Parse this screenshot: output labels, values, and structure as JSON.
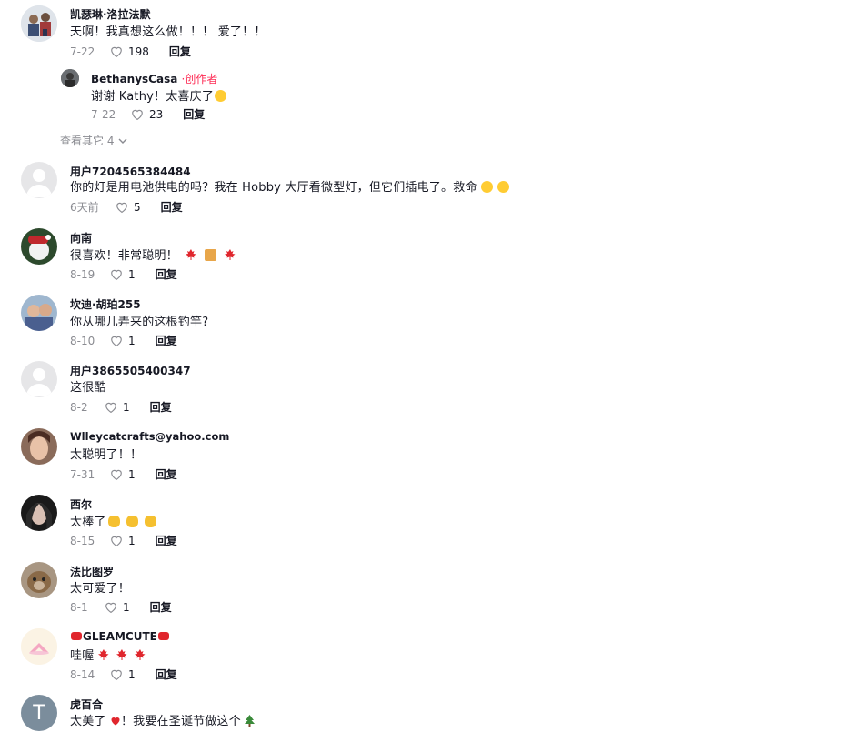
{
  "comments": [
    {
      "name": "凯瑟琳·洛拉法默",
      "text": "天啊！我真想这么做！！！ 爱了！！",
      "date": "7-22",
      "likes": "198",
      "reply": "回复"
    },
    {
      "name": "用户7204565384484",
      "text": "你的灯是用电池供电的吗？我在 Hobby 大厅看微型灯，但它们插电了。救命",
      "date": "6天前",
      "likes": "5",
      "reply": "回复"
    },
    {
      "name": "向南",
      "text": "很喜欢！非常聪明！",
      "date": "8-19",
      "likes": "1",
      "reply": "回复"
    },
    {
      "name": "坎迪·胡珀255",
      "text": "你从哪儿弄来的这根钓竿?",
      "date": "8-10",
      "likes": "1",
      "reply": "回复"
    },
    {
      "name": "用户3865505400347",
      "text": "这很酷",
      "date": "8-2",
      "likes": "1",
      "reply": "回复"
    },
    {
      "name": "Wlleycatcrafts@yahoo.com",
      "text": "太聪明了！！",
      "date": "7-31",
      "likes": "1",
      "reply": "回复"
    },
    {
      "name": "西尔",
      "text": "太棒了",
      "date": "8-15",
      "likes": "1",
      "reply": "回复"
    },
    {
      "name": "法比图罗",
      "text": "太可爱了！",
      "date": "8-1",
      "likes": "1",
      "reply": "回复"
    },
    {
      "name": "GLEAMCUTE",
      "text": "哇喔",
      "date": "8-14",
      "likes": "1",
      "reply": "回复"
    },
    {
      "name": "虎百合",
      "text": "太美了",
      "text_tail": "！我要在圣诞节做这个",
      "avatar_letter": "T"
    }
  ],
  "reply": {
    "name": "BethanysCasa",
    "creator_label": "·创作者",
    "text": "谢谢 Kathy！太喜庆了",
    "date": "7-22",
    "likes": "23",
    "reply": "回复"
  },
  "view_more": "查看其它 4",
  "colors": {
    "accent": "#fe2c55",
    "muted": "#8a8b91",
    "text": "#161823"
  }
}
